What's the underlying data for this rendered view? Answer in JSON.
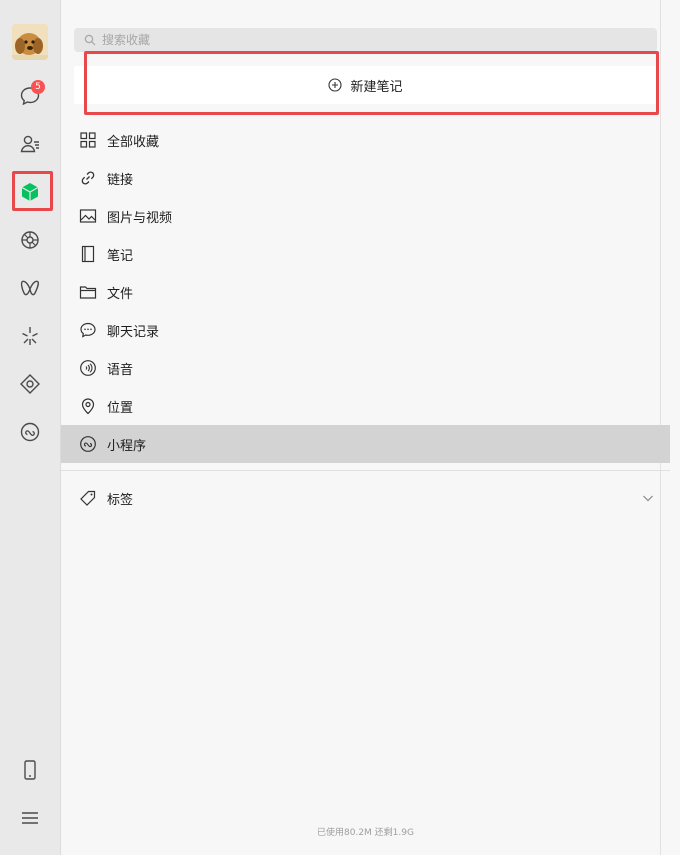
{
  "rail": {
    "chat_badge": "5",
    "items": [
      {
        "icon": "chat-icon"
      },
      {
        "icon": "contacts-icon"
      },
      {
        "icon": "favorites-icon",
        "active": true,
        "color": "#07c160"
      },
      {
        "icon": "moments-icon"
      },
      {
        "icon": "channels-icon"
      },
      {
        "icon": "discover-icon"
      },
      {
        "icon": "search-square-icon"
      },
      {
        "icon": "mini-program-icon"
      }
    ],
    "bottom": [
      {
        "icon": "phone-icon"
      },
      {
        "icon": "menu-icon"
      }
    ]
  },
  "search": {
    "placeholder": "搜索收藏",
    "value": ""
  },
  "new_note": {
    "label": "新建笔记"
  },
  "menu": {
    "items": [
      {
        "label": "全部收藏",
        "icon": "grid-icon"
      },
      {
        "label": "链接",
        "icon": "link-icon"
      },
      {
        "label": "图片与视频",
        "icon": "image-icon"
      },
      {
        "label": "笔记",
        "icon": "notebook-icon"
      },
      {
        "label": "文件",
        "icon": "folder-icon"
      },
      {
        "label": "聊天记录",
        "icon": "chat-record-icon"
      },
      {
        "label": "语音",
        "icon": "voice-icon"
      },
      {
        "label": "位置",
        "icon": "location-icon"
      },
      {
        "label": "小程序",
        "icon": "mini-program-icon",
        "active": true
      }
    ]
  },
  "tags": {
    "label": "标签"
  },
  "storage": {
    "text": "已使用80.2M 还剩1.9G"
  },
  "colors": {
    "accent": "#07c160",
    "highlight_box": "#e8484c",
    "badge": "#fa5151",
    "active_row": "#d3d3d3"
  }
}
